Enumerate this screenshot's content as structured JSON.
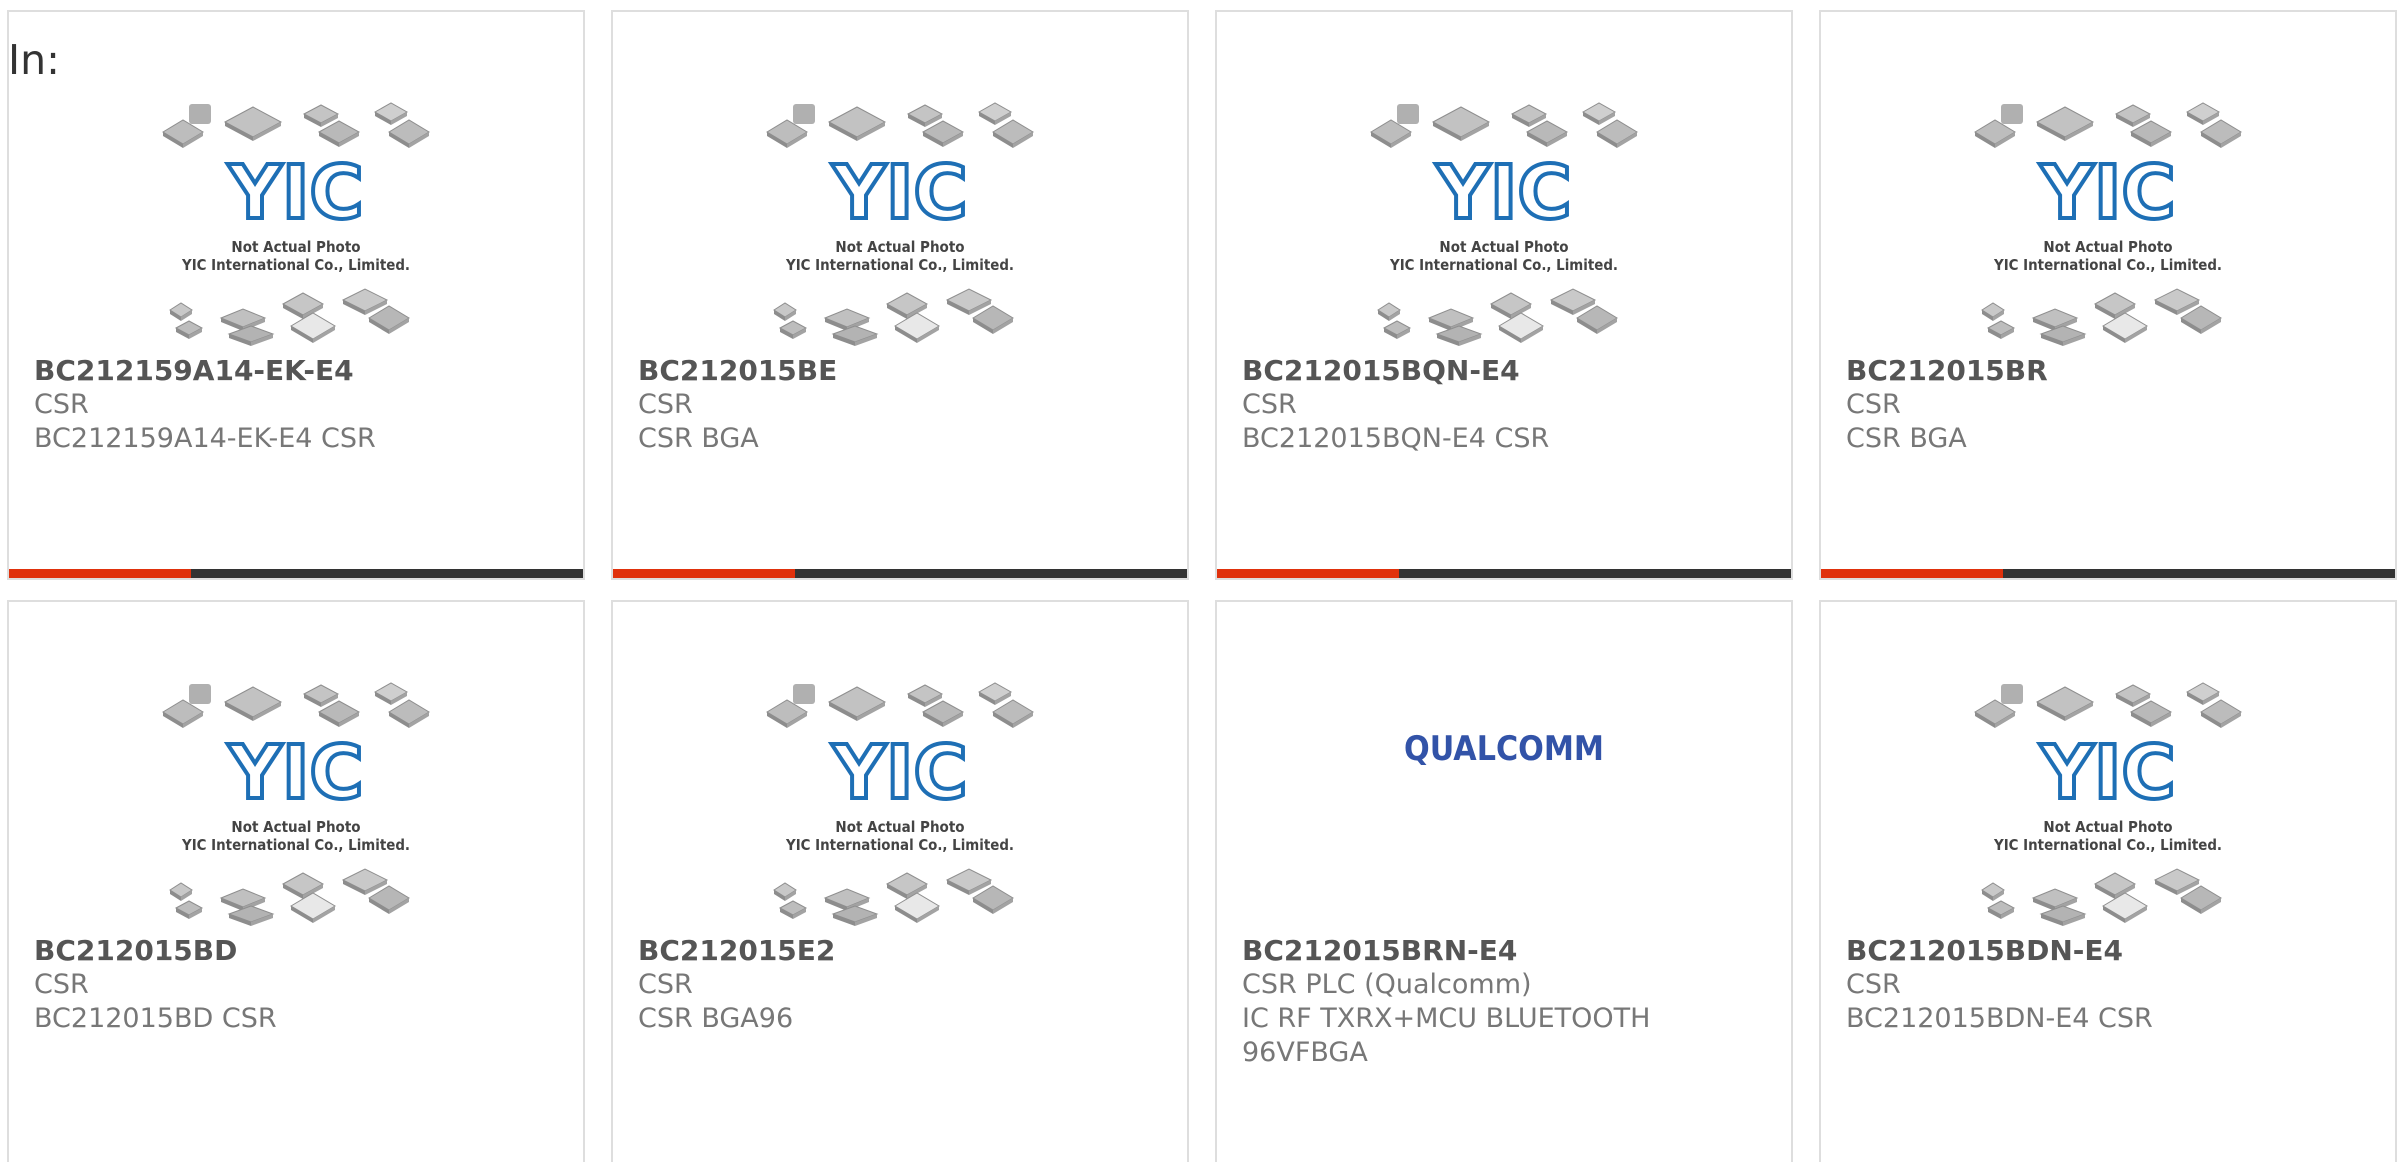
{
  "header": {
    "in_label": "In:"
  },
  "colors": {
    "accent": "#e0310c",
    "bar": "#333333",
    "yic_blue": "#1e6fb5",
    "qualcomm_blue": "#3253a8"
  },
  "placeholder": {
    "line1": "Not Actual Photo",
    "line2": "YIC International Co., Limited.",
    "logo_text": "YIC"
  },
  "qualcomm": {
    "logo_text": "QUALCOMM"
  },
  "products": [
    {
      "part": "BC212159A14-EK-E4",
      "manufacturer": "CSR",
      "description": "BC212159A14-EK-E4 CSR",
      "image": "yic-placeholder"
    },
    {
      "part": "BC212015BE",
      "manufacturer": "CSR",
      "description": "CSR BGA",
      "image": "yic-placeholder"
    },
    {
      "part": "BC212015BQN-E4",
      "manufacturer": "CSR",
      "description": "BC212015BQN-E4 CSR",
      "image": "yic-placeholder"
    },
    {
      "part": "BC212015BR",
      "manufacturer": "CSR",
      "description": "CSR BGA",
      "image": "yic-placeholder"
    },
    {
      "part": "BC212015BD",
      "manufacturer": "CSR",
      "description": "BC212015BD CSR",
      "image": "yic-placeholder"
    },
    {
      "part": "BC212015E2",
      "manufacturer": "CSR",
      "description": "CSR BGA96",
      "image": "yic-placeholder"
    },
    {
      "part": "BC212015BRN-E4",
      "manufacturer": "CSR PLC (Qualcomm)",
      "description": "IC RF TXRX+MCU BLUETOOTH\n96VFBGA",
      "image": "qualcomm-logo"
    },
    {
      "part": "BC212015BDN-E4",
      "manufacturer": "CSR",
      "description": "BC212015BDN-E4 CSR",
      "image": "yic-placeholder"
    }
  ]
}
